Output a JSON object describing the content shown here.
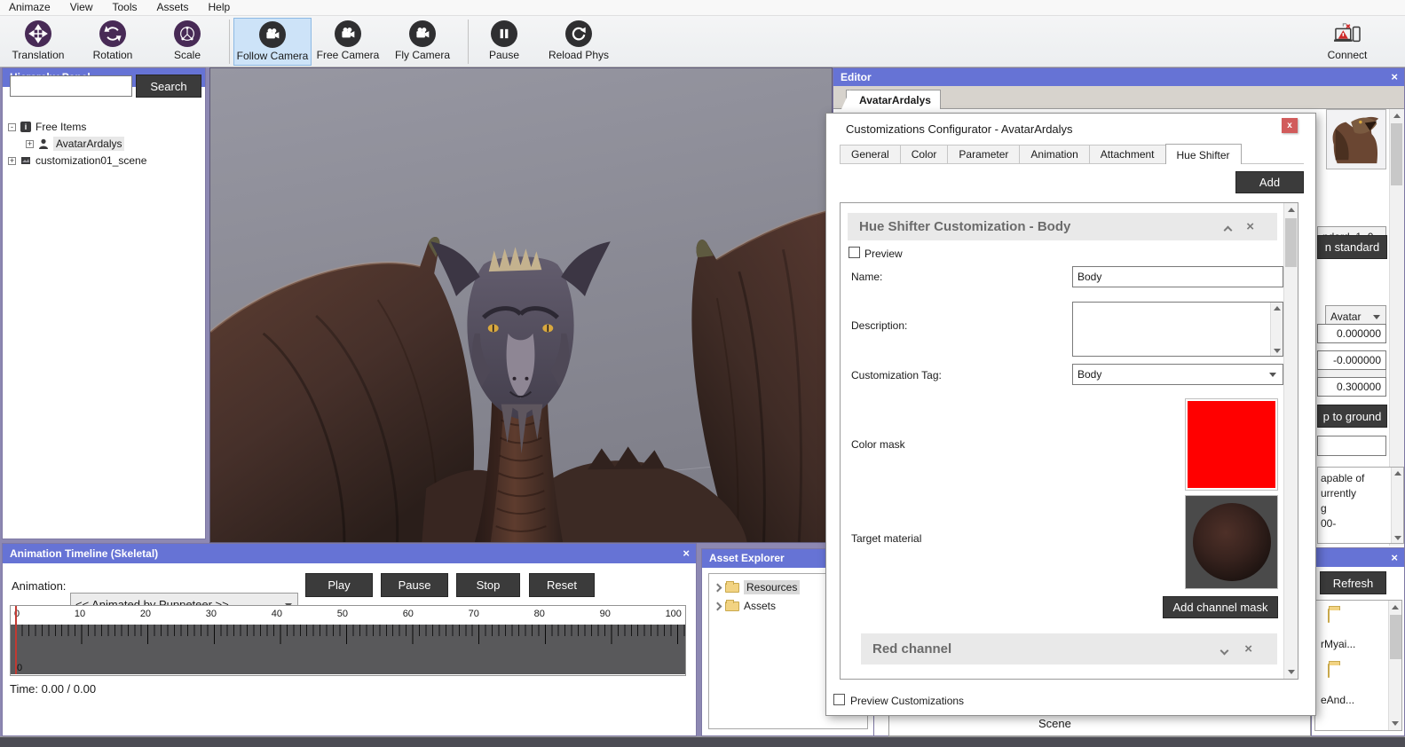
{
  "menu": {
    "items": [
      "Animaze",
      "View",
      "Tools",
      "Assets",
      "Help"
    ]
  },
  "toolbar": {
    "translation": "Translation",
    "rotation": "Rotation",
    "scale": "Scale",
    "follow_camera": "Follow Camera",
    "free_camera": "Free Camera",
    "fly_camera": "Fly Camera",
    "pause": "Pause",
    "reload_phys": "Reload Phys",
    "connect": "Connect"
  },
  "hierarchy": {
    "title": "Hierarchy Panel",
    "search_value": "",
    "search_button": "Search",
    "items": [
      {
        "label": "Free Items",
        "expander": "-"
      },
      {
        "label": "AvatarArdalys",
        "expander": "+"
      },
      {
        "label": "customization01_scene",
        "expander": "+"
      }
    ]
  },
  "timeline": {
    "title": "Animation Timeline (Skeletal)",
    "animation_label": "Animation:",
    "animation_value": "<< Animated by Puppeteer >>",
    "play": "Play",
    "pause": "Pause",
    "stop": "Stop",
    "reset": "Reset",
    "ruler": [
      "0",
      "10",
      "20",
      "30",
      "40",
      "50",
      "60",
      "70",
      "80",
      "90",
      "100"
    ],
    "playhead_label": "0",
    "time": "Time: 0.00 / 0.00"
  },
  "asset_explorer": {
    "title": "Asset Explorer",
    "items": [
      "Resources",
      "Assets"
    ]
  },
  "editor": {
    "title": "Editor",
    "tab": "AvatarArdalys",
    "scene_label": "Scene",
    "right_panel": {
      "dropdown1": "ndard_1_0",
      "button1": "n standard",
      "dropdown2": "Avatar",
      "field1": "0.000000",
      "field2": "-0.000000",
      "field3": "0.300000",
      "button2": "p to ground",
      "info_line1": "apable of",
      "info_line2": "urrently",
      "info_line3": "g",
      "info_line4": "00-",
      "refresh": "Refresh",
      "asset1": "rMyai...",
      "asset2": "eAnd..."
    }
  },
  "dialog": {
    "title": "Customizations Configurator - AvatarArdalys",
    "close": "x",
    "tabs": [
      "General",
      "Color",
      "Parameter",
      "Animation",
      "Attachment",
      "Hue Shifter"
    ],
    "active_tab": "Hue Shifter",
    "add_button": "Add",
    "section": {
      "title": "Hue Shifter Customization - Body",
      "preview_label": "Preview",
      "name_label": "Name:",
      "name_value": "Body",
      "description_label": "Description:",
      "description_value": "",
      "tag_label": "Customization Tag:",
      "tag_value": "Body",
      "color_mask_label": "Color mask",
      "color_mask_color": "#ff0000",
      "target_material_label": "Target material",
      "add_channel_mask": "Add channel mask",
      "red_channel_title": "Red channel"
    },
    "preview_customizations": "Preview Customizations"
  },
  "colors": {
    "titlebar": "#6673d5",
    "dark_button": "#3b3b3b",
    "selected_tool_bg": "#cde3f8",
    "color_mask": "#ff0000",
    "viewport_top": "#9797a2",
    "viewport_bottom": "#7f7f89"
  }
}
